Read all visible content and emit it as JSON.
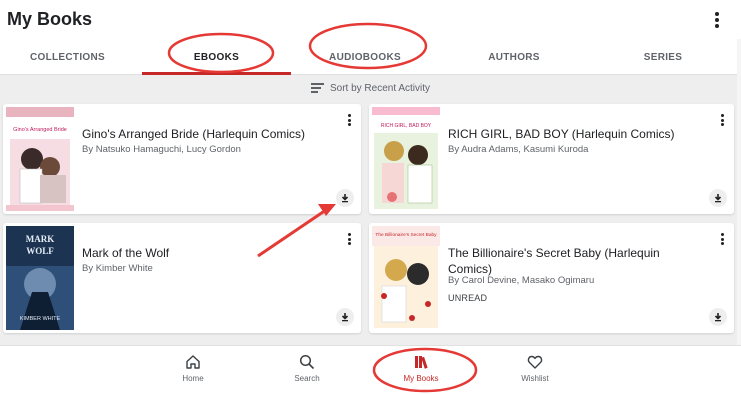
{
  "header": {
    "title": "My Books"
  },
  "tabs": [
    {
      "label": "COLLECTIONS"
    },
    {
      "label": "EBOOKS"
    },
    {
      "label": "AUDIOBOOKS"
    },
    {
      "label": "AUTHORS"
    },
    {
      "label": "SERIES"
    }
  ],
  "active_tab": "EBOOKS",
  "sort": {
    "label": "Sort by Recent Activity"
  },
  "books": [
    {
      "title": "Gino's Arranged Bride (Harlequin Comics)",
      "author": "By Natsuko Hamaguchi, Lucy Gordon",
      "status": "",
      "cover_title": "Gino's Arranged Bride",
      "cover_color": "#f3c6cf"
    },
    {
      "title": "RICH GIRL, BAD BOY (Harlequin Comics)",
      "author": "By Audra Adams, Kasumi Kuroda",
      "status": "",
      "cover_title": "RICH GIRL, BAD BOY",
      "cover_color": "#d7e8c8"
    },
    {
      "title": "Mark of the Wolf",
      "author": "By Kimber White",
      "status": "",
      "cover_title": "MARK OF THE WOLF",
      "cover_sub": "KIMBER WHITE",
      "cover_color": "#1c3352"
    },
    {
      "title": "The Billionaire's Secret Baby (Harlequin Comics)",
      "author": "By Carol Devine, Masako Ogimaru",
      "status": "UNREAD",
      "cover_title": "The Billionaire's Secret Baby",
      "cover_color": "#f7e7c8"
    }
  ],
  "bottom_nav": [
    {
      "label": "Home",
      "icon": "home-icon"
    },
    {
      "label": "Search",
      "icon": "search-icon"
    },
    {
      "label": "My Books",
      "icon": "books-icon"
    },
    {
      "label": "Wishlist",
      "icon": "heart-icon"
    }
  ],
  "colors": {
    "accent": "#c62828",
    "annotation": "#e53935"
  }
}
